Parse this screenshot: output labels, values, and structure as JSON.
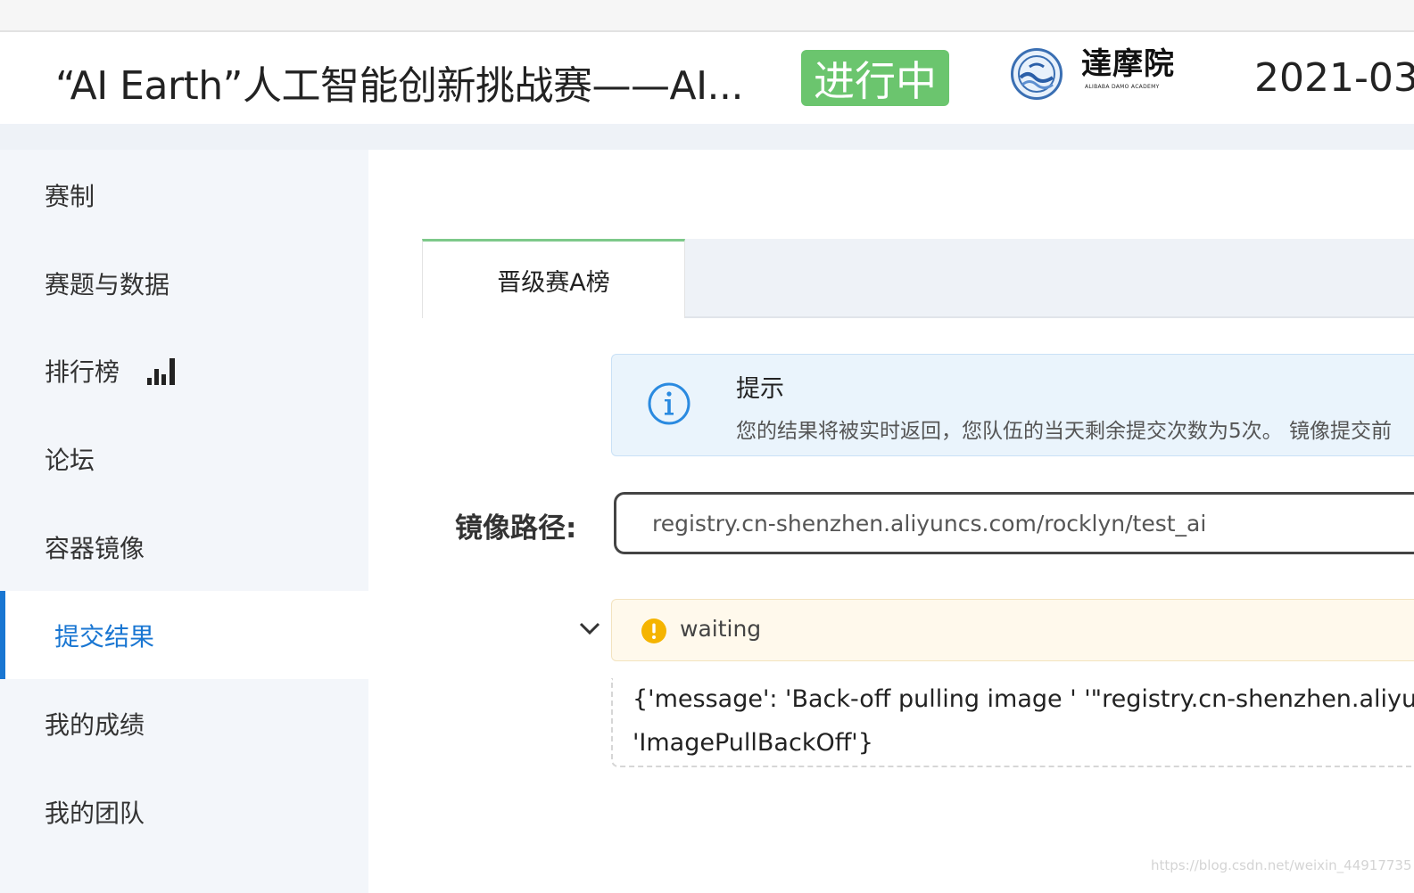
{
  "header": {
    "title": "“AI Earth”人工智能创新挑战赛——AI...",
    "status": "进行中",
    "logo_name": "達摩院",
    "logo_subtitle": "ALIBABA DAMO ACADEMY",
    "date": "2021-03"
  },
  "sidebar": {
    "items": [
      {
        "label": "赛制"
      },
      {
        "label": "赛题与数据"
      },
      {
        "label": "排行榜",
        "icon": "bar-chart-icon"
      },
      {
        "label": "论坛"
      },
      {
        "label": "容器镜像"
      },
      {
        "label": "提交结果",
        "active": true
      },
      {
        "label": "我的成绩"
      },
      {
        "label": "我的团队"
      }
    ]
  },
  "main": {
    "tabs": [
      {
        "label": "晋级赛A榜",
        "active": true
      }
    ],
    "tip": {
      "title": "提示",
      "text": "您的结果将被实时返回，您队伍的当天剩余提交次数为5次。 镜像提交前"
    },
    "image_path": {
      "label": "镜像路径:",
      "value": "registry.cn-shenzhen.aliyuncs.com/rocklyn/test_ai"
    },
    "result": {
      "status": "waiting",
      "log_line1": "{'message': 'Back-off pulling image ' '\"registry.cn-shenzhen.aliyun",
      "log_line2": "'ImagePullBackOff'}"
    }
  },
  "watermark": "https://blog.csdn.net/weixin_44917735",
  "colors": {
    "accent_blue": "#1976d2",
    "status_green": "#6bc56e",
    "tab_green": "#7dc98a",
    "tip_bg": "#eaf4fc",
    "warn_bg": "#fff9ec",
    "warn_yellow": "#f5b400"
  }
}
